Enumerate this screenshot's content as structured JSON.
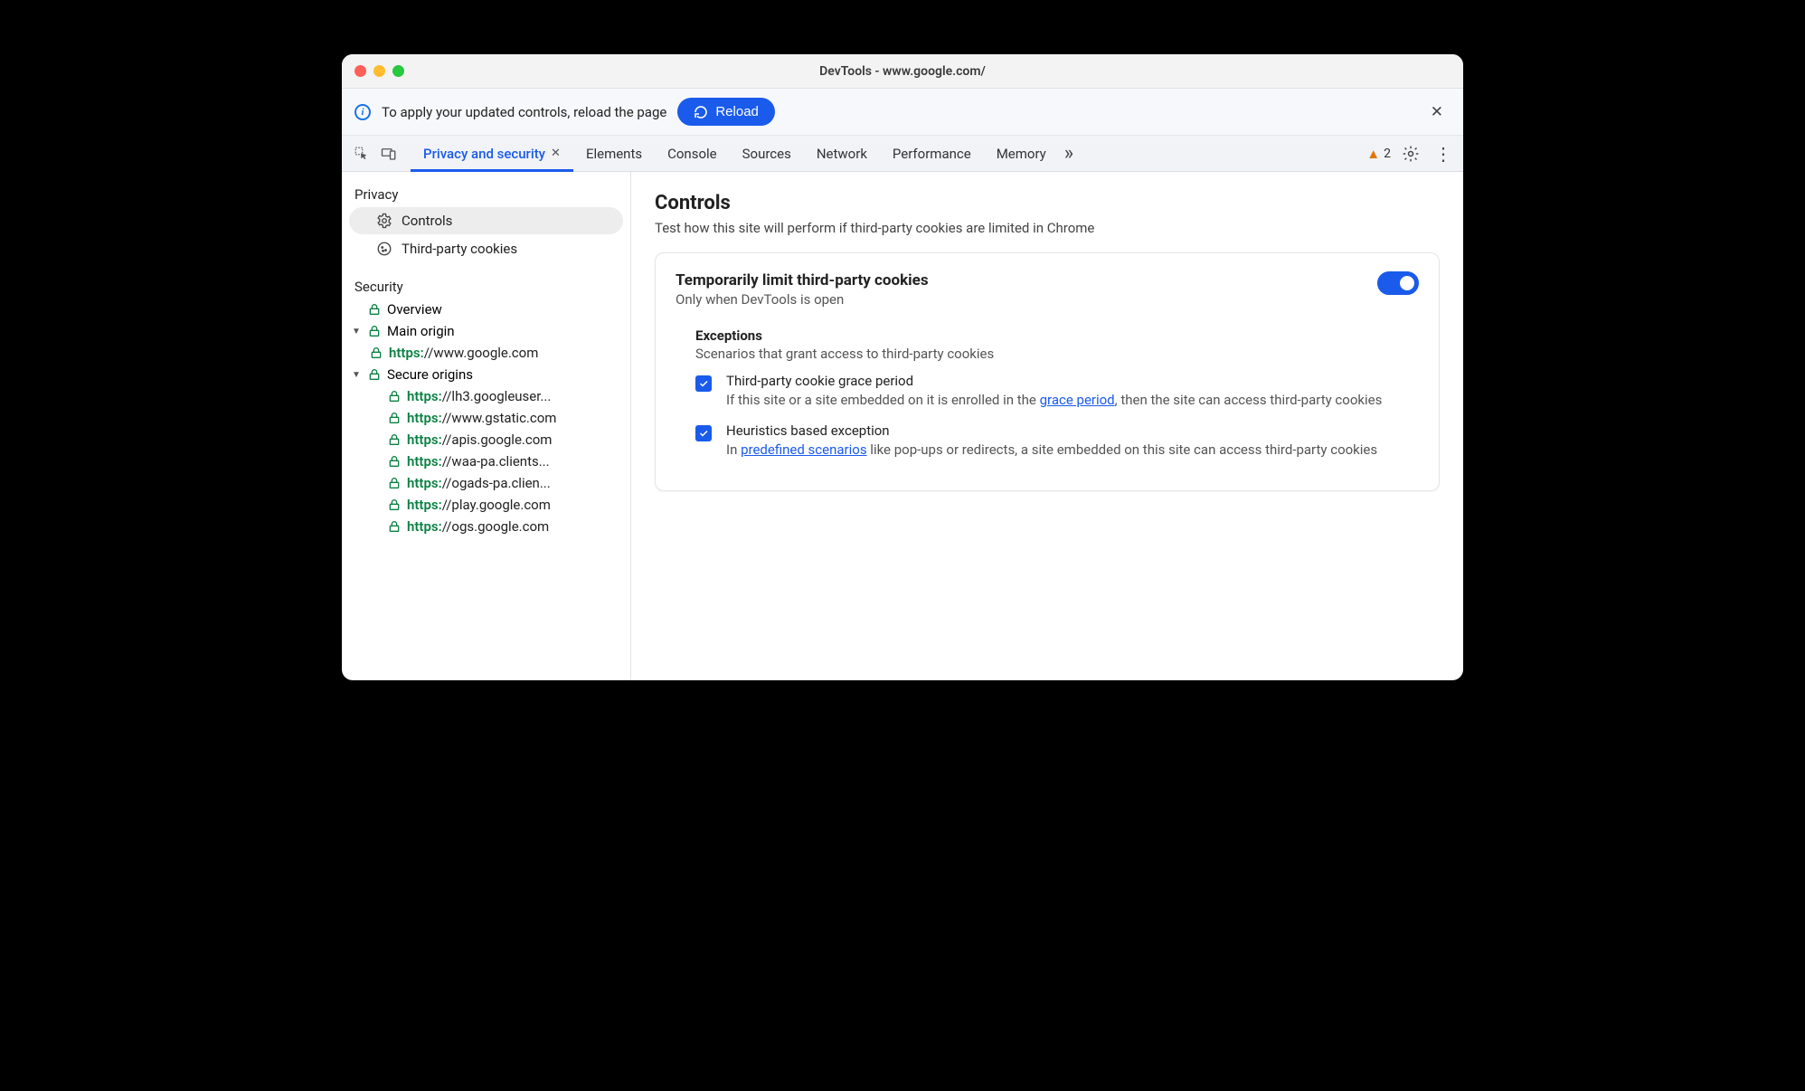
{
  "window": {
    "title": "DevTools - www.google.com/"
  },
  "infobar": {
    "message": "To apply your updated controls, reload the page",
    "reload_label": "Reload"
  },
  "tabs": {
    "active": "Privacy and security",
    "items": [
      "Privacy and security",
      "Elements",
      "Console",
      "Sources",
      "Network",
      "Performance",
      "Memory"
    ]
  },
  "toolbar": {
    "warning_count": "2"
  },
  "sidebar": {
    "privacy_heading": "Privacy",
    "privacy_items": [
      {
        "label": "Controls",
        "icon": "gear"
      },
      {
        "label": "Third-party cookies",
        "icon": "cookie"
      }
    ],
    "security_heading": "Security",
    "overview_label": "Overview",
    "main_origin_label": "Main origin",
    "main_origin_url": {
      "scheme": "https:",
      "rest": "//www.google.com"
    },
    "secure_origins_label": "Secure origins",
    "secure_origins": [
      {
        "scheme": "https:",
        "rest": "//lh3.googleuser..."
      },
      {
        "scheme": "https:",
        "rest": "//www.gstatic.com"
      },
      {
        "scheme": "https:",
        "rest": "//apis.google.com"
      },
      {
        "scheme": "https:",
        "rest": "//waa-pa.clients..."
      },
      {
        "scheme": "https:",
        "rest": "//ogads-pa.clien..."
      },
      {
        "scheme": "https:",
        "rest": "//play.google.com"
      },
      {
        "scheme": "https:",
        "rest": "//ogs.google.com"
      }
    ]
  },
  "main": {
    "title": "Controls",
    "subtitle": "Test how this site will perform if third-party cookies are limited in Chrome",
    "card": {
      "title": "Temporarily limit third-party cookies",
      "subtitle": "Only when DevTools is open",
      "exceptions_heading": "Exceptions",
      "exceptions_sub": "Scenarios that grant access to third-party cookies",
      "opt1_title": "Third-party cookie grace period",
      "opt1_pre": "If this site or a site embedded on it is enrolled in the ",
      "opt1_link": "grace period",
      "opt1_post": ", then the site can access third-party cookies",
      "opt2_title": "Heuristics based exception",
      "opt2_pre": "In ",
      "opt2_link": "predefined scenarios",
      "opt2_post": " like pop-ups or redirects, a site embedded on this site can access third-party cookies"
    }
  }
}
